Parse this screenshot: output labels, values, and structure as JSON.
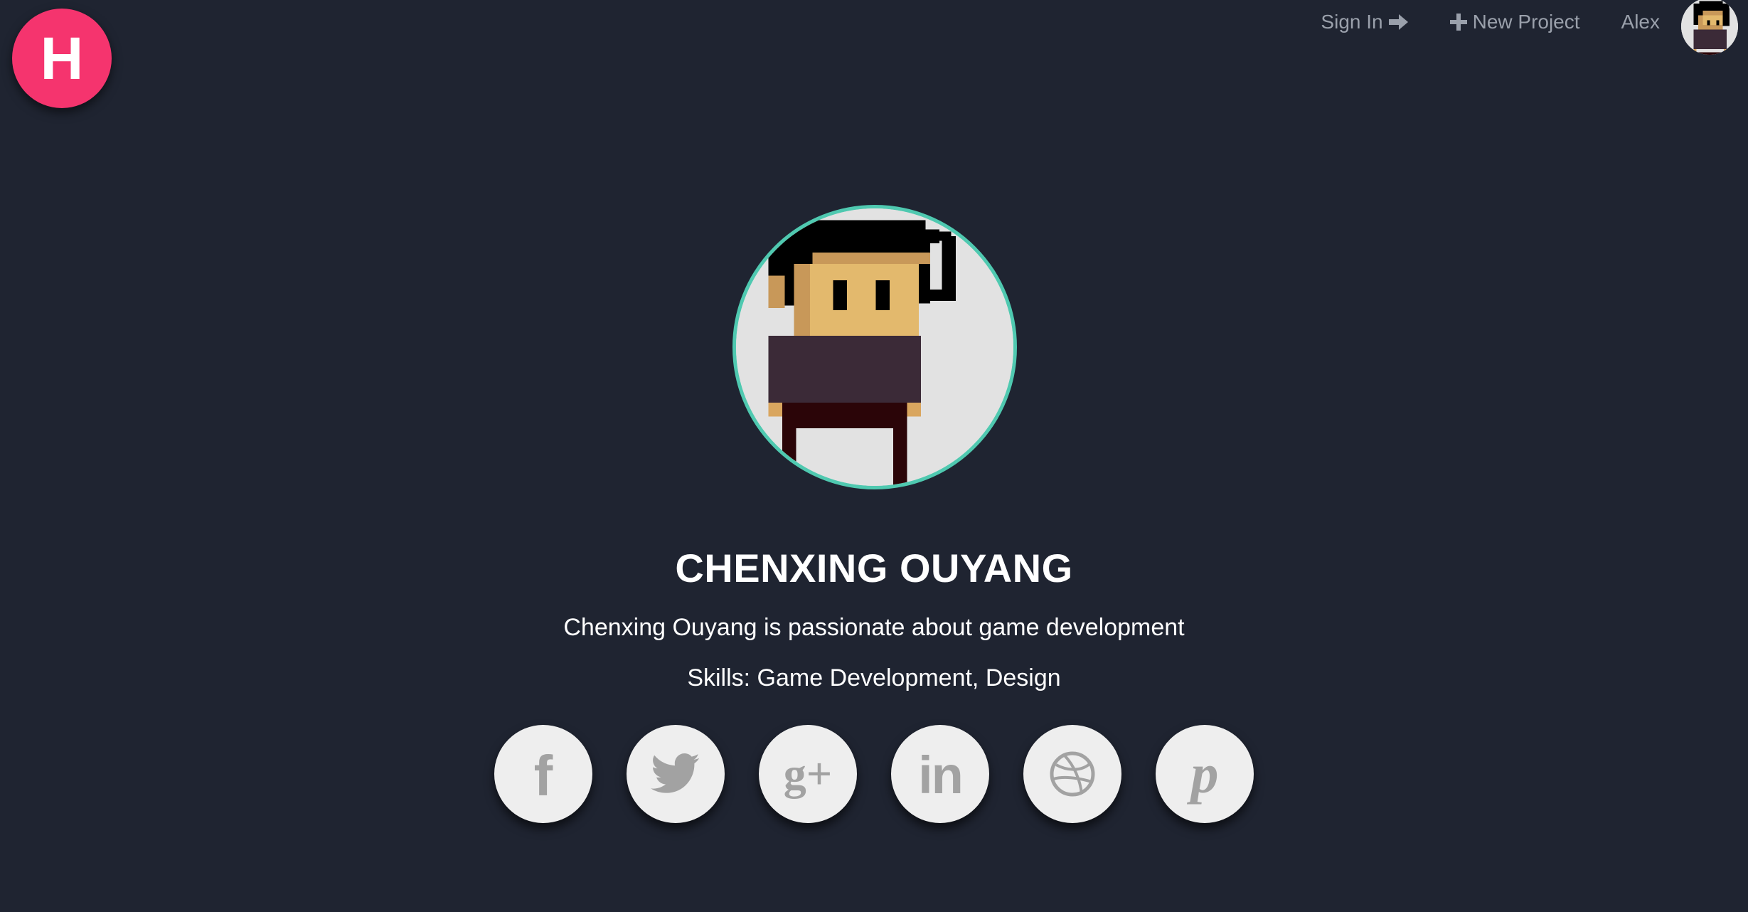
{
  "logo": {
    "letter": "H",
    "color": "#f5346e"
  },
  "nav": {
    "sign_in_label": "Sign In",
    "sign_in_icon": "arrow-right-icon",
    "new_project_label": "New Project",
    "new_project_icon": "plus-icon",
    "user_name": "Alex",
    "user_avatar": "pixel-avatar"
  },
  "profile": {
    "avatar": "pixel-avatar",
    "avatar_border_color": "#4fc9b0",
    "name": "CHENXING OUYANG",
    "bio": "Chenxing Ouyang is passionate about game development",
    "skills": "Skills: Game Development, Design"
  },
  "social": [
    {
      "icon": "facebook-icon",
      "glyph": "f"
    },
    {
      "icon": "twitter-icon"
    },
    {
      "icon": "google-plus-icon",
      "glyph": "g+"
    },
    {
      "icon": "linkedin-icon",
      "glyph": "in"
    },
    {
      "icon": "dribbble-icon"
    },
    {
      "icon": "pinterest-icon",
      "glyph": "p"
    }
  ],
  "colors": {
    "background": "#1f2431",
    "nav_text": "#9aa0ab",
    "social_bg": "#eeeeee",
    "social_icon": "#a2a2a2"
  }
}
